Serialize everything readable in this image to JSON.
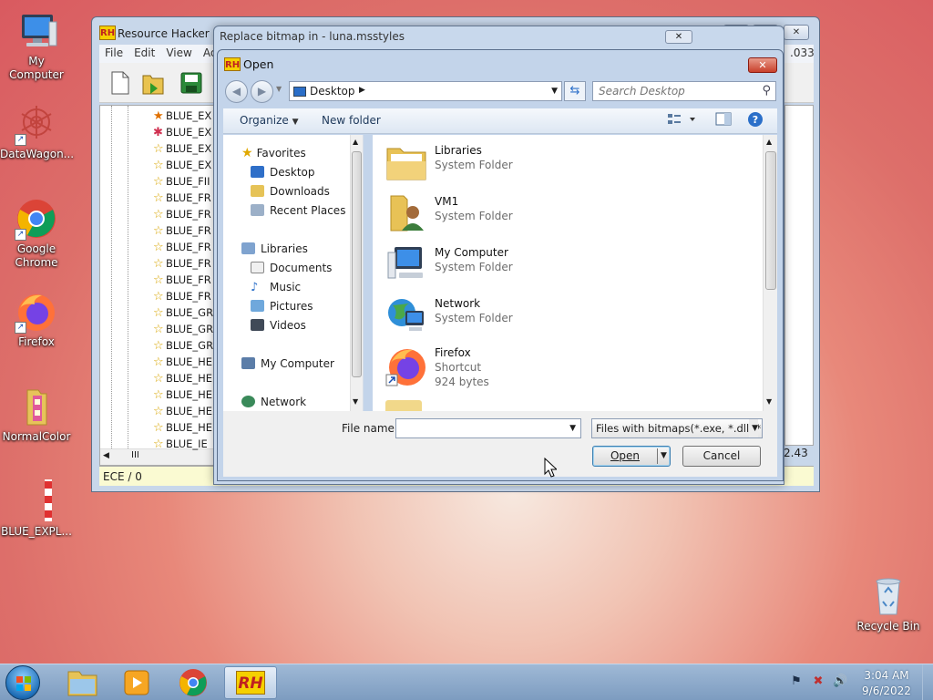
{
  "desktop": {
    "icons": [
      {
        "label": "My Computer",
        "icon": "monitor-icon"
      },
      {
        "label": "DataWagon...",
        "icon": "snowflake-icon"
      },
      {
        "label": "Google Chrome",
        "icon": "chrome-icon"
      },
      {
        "label": "Firefox",
        "icon": "firefox-icon"
      },
      {
        "label": "NormalColor",
        "icon": "folder-icon"
      },
      {
        "label": "BLUE_EXPL...",
        "icon": "bitmap-strip-icon"
      },
      {
        "label": "Recycle Bin",
        "icon": "recycle-bin-icon"
      }
    ]
  },
  "rh_window": {
    "title": "Resource Hacker - l",
    "menu": [
      "File",
      "Edit",
      "View",
      "Ac"
    ],
    "version_fragment": ".033",
    "tree_items": [
      "BLUE_EX",
      "BLUE_EX",
      "BLUE_EX",
      "BLUE_EX",
      "BLUE_FII",
      "BLUE_FR",
      "BLUE_FR",
      "BLUE_FR",
      "BLUE_FR",
      "BLUE_FR",
      "BLUE_FR",
      "BLUE_FR",
      "BLUE_GR",
      "BLUE_GR",
      "BLUE_GR",
      "BLUE_HE",
      "BLUE_HE",
      "BLUE_HE",
      "BLUE_HE",
      "BLUE_HE",
      "BLUE_IE"
    ],
    "status": "ECE / 0",
    "right_value": "2.43",
    "hscroll_label": "III"
  },
  "replace_dialog": {
    "title": "Replace bitmap in - luna.msstyles"
  },
  "open_dialog": {
    "title": "Open",
    "close_glyph": "✕",
    "address": "Desktop",
    "search_placeholder": "Search Desktop",
    "organize_label": "Organize",
    "new_folder_label": "New folder",
    "nav": {
      "favorites": "Favorites",
      "favorites_items": [
        "Desktop",
        "Downloads",
        "Recent Places"
      ],
      "libraries": "Libraries",
      "libraries_items": [
        "Documents",
        "Music",
        "Pictures",
        "Videos"
      ],
      "my_computer": "My Computer",
      "network": "Network"
    },
    "files": [
      {
        "name": "Libraries",
        "type": "System Folder",
        "icon": "libraries-folder-icon"
      },
      {
        "name": "VM1",
        "type": "System Folder",
        "icon": "user-folder-icon"
      },
      {
        "name": "My Computer",
        "type": "System Folder",
        "icon": "computer-icon"
      },
      {
        "name": "Network",
        "type": "System Folder",
        "icon": "network-icon"
      },
      {
        "name": "Firefox",
        "type": "Shortcut",
        "size": "924 bytes",
        "icon": "firefox-icon"
      }
    ],
    "file_name_label": "File name:",
    "file_name_value": "",
    "file_type": "Files with bitmaps(*.exe, *.dll, *.",
    "open_button": "Open",
    "cancel_button": "Cancel"
  },
  "taskbar": {
    "time": "3:04 AM",
    "date": "9/6/2022",
    "rh_label": "RH"
  },
  "colors": {
    "accent": "#2b6fc9",
    "close_red": "#c9402b"
  }
}
